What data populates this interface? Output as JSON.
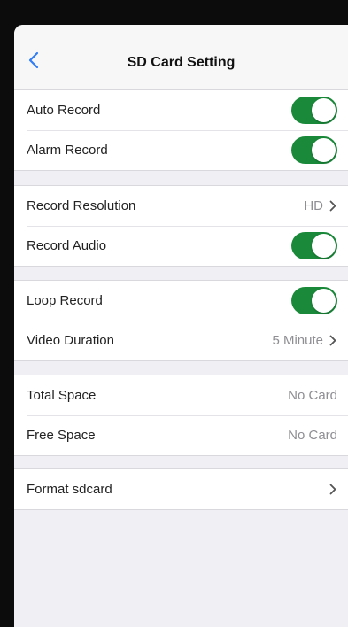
{
  "header": {
    "title": "SD Card Setting",
    "back_icon": "chevron-left-icon"
  },
  "groups": [
    [
      {
        "label": "Auto Record",
        "type": "toggle",
        "on": true
      },
      {
        "label": "Alarm Record",
        "type": "toggle",
        "on": true
      }
    ],
    [
      {
        "label": "Record Resolution",
        "type": "value",
        "value": "HD",
        "chevron": true
      },
      {
        "label": "Record Audio",
        "type": "toggle",
        "on": true
      }
    ],
    [
      {
        "label": "Loop Record",
        "type": "toggle",
        "on": true
      },
      {
        "label": "Video Duration",
        "type": "value",
        "value": "5 Minute",
        "chevron": true
      }
    ],
    [
      {
        "label": "Total Space",
        "type": "value",
        "value": "No Card",
        "chevron": false
      },
      {
        "label": "Free Space",
        "type": "value",
        "value": "No Card",
        "chevron": false
      }
    ],
    [
      {
        "label": "Format sdcard",
        "type": "value",
        "value": "",
        "chevron": true
      }
    ]
  ],
  "colors": {
    "toggle_on": "#1a8a3a",
    "accent": "#2f7cf6",
    "background": "#efeff4"
  }
}
